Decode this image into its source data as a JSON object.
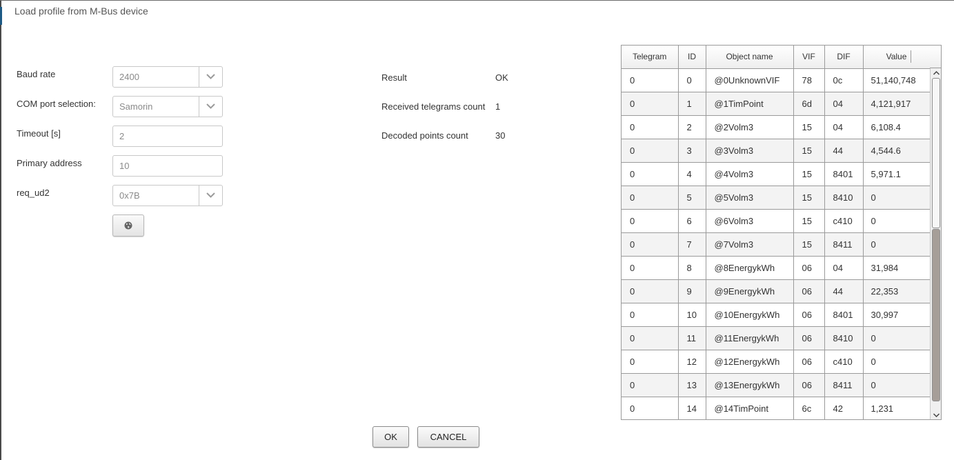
{
  "dialog": {
    "title": "Load profile from M-Bus device"
  },
  "form": {
    "baud_rate": {
      "label": "Baud rate",
      "value": "2400"
    },
    "com_port": {
      "label": "COM port selection:",
      "value": "Samorin"
    },
    "timeout": {
      "label": "Timeout [s]",
      "value": "2"
    },
    "primary_address": {
      "label": "Primary address",
      "value": "10"
    },
    "req_ud2": {
      "label": "req_ud2",
      "value": "0x7B"
    },
    "action_icon": "globe-icon"
  },
  "results": {
    "result": {
      "label": "Result",
      "value": "OK"
    },
    "telegrams": {
      "label": "Received telegrams count",
      "value": "1"
    },
    "points": {
      "label": "Decoded points count",
      "value": "30"
    }
  },
  "table": {
    "columns": [
      "Telegram",
      "ID",
      "Object name",
      "VIF",
      "DIF",
      "Value"
    ],
    "rows": [
      [
        "0",
        "0",
        "@0UnknownVIF",
        "78",
        "0c",
        "51,140,748"
      ],
      [
        "0",
        "1",
        "@1TimPoint",
        "6d",
        "04",
        "4,121,917"
      ],
      [
        "0",
        "2",
        "@2Volm3",
        "15",
        "04",
        "6,108.4"
      ],
      [
        "0",
        "3",
        "@3Volm3",
        "15",
        "44",
        "4,544.6"
      ],
      [
        "0",
        "4",
        "@4Volm3",
        "15",
        "8401",
        "5,971.1"
      ],
      [
        "0",
        "5",
        "@5Volm3",
        "15",
        "8410",
        "0"
      ],
      [
        "0",
        "6",
        "@6Volm3",
        "15",
        "c410",
        "0"
      ],
      [
        "0",
        "7",
        "@7Volm3",
        "15",
        "8411",
        "0"
      ],
      [
        "0",
        "8",
        "@8EnergykWh",
        "06",
        "04",
        "31,984"
      ],
      [
        "0",
        "9",
        "@9EnergykWh",
        "06",
        "44",
        "22,353"
      ],
      [
        "0",
        "10",
        "@10EnergykWh",
        "06",
        "8401",
        "30,997"
      ],
      [
        "0",
        "11",
        "@11EnergykWh",
        "06",
        "8410",
        "0"
      ],
      [
        "0",
        "12",
        "@12EnergykWh",
        "06",
        "c410",
        "0"
      ],
      [
        "0",
        "13",
        "@13EnergykWh",
        "06",
        "8411",
        "0"
      ],
      [
        "0",
        "14",
        "@14TimPoint",
        "6c",
        "42",
        "1,231"
      ]
    ]
  },
  "buttons": {
    "ok": "OK",
    "cancel": "CANCEL"
  }
}
